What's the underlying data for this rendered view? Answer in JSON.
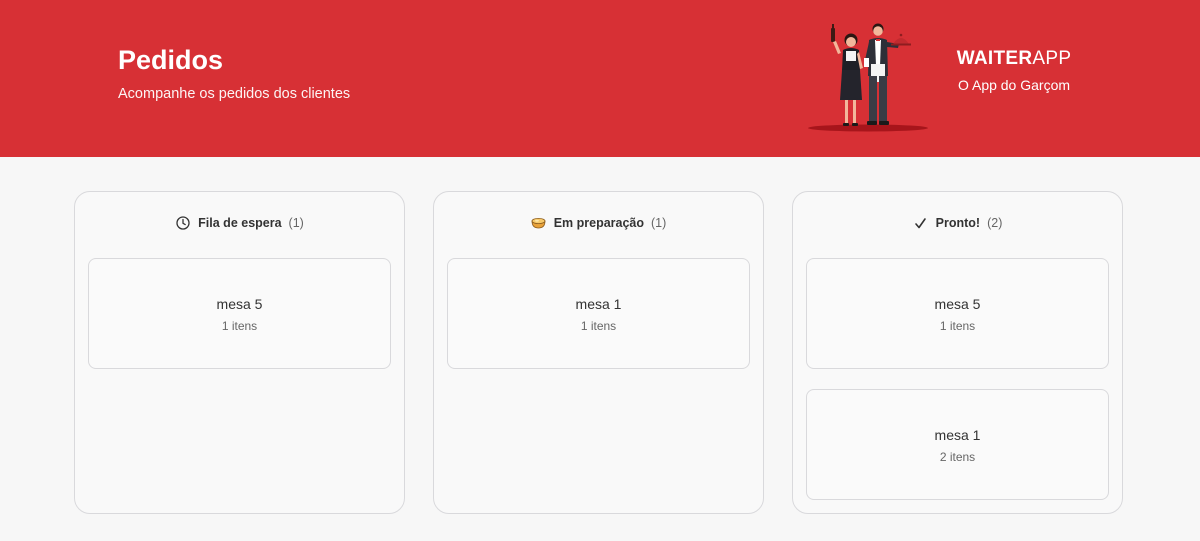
{
  "header": {
    "title": "Pedidos",
    "subtitle": "Acompanhe os pedidos dos clientes",
    "illustration_icon": "waiters-illustration",
    "brand": {
      "logo_strong": "WAITER",
      "logo_light": "APP",
      "tagline": "O App do Garçom"
    },
    "colors": {
      "brand_red": "#d73035",
      "background": "#f7f7f7",
      "border": "#d9d9dc"
    }
  },
  "boards": [
    {
      "icon": "clock-icon",
      "title": "Fila de espera",
      "count": "(1)",
      "orders": [
        {
          "table": "mesa 5",
          "items": "1 itens"
        }
      ]
    },
    {
      "icon": "cooking-pot-emoji",
      "title": "Em preparação",
      "count": "(1)",
      "orders": [
        {
          "table": "mesa 1",
          "items": "1 itens"
        }
      ]
    },
    {
      "icon": "check-mark-icon",
      "title": "Pronto!",
      "count": "(2)",
      "orders": [
        {
          "table": "mesa 5",
          "items": "1 itens"
        },
        {
          "table": "mesa 1",
          "items": "2 itens"
        }
      ]
    }
  ]
}
